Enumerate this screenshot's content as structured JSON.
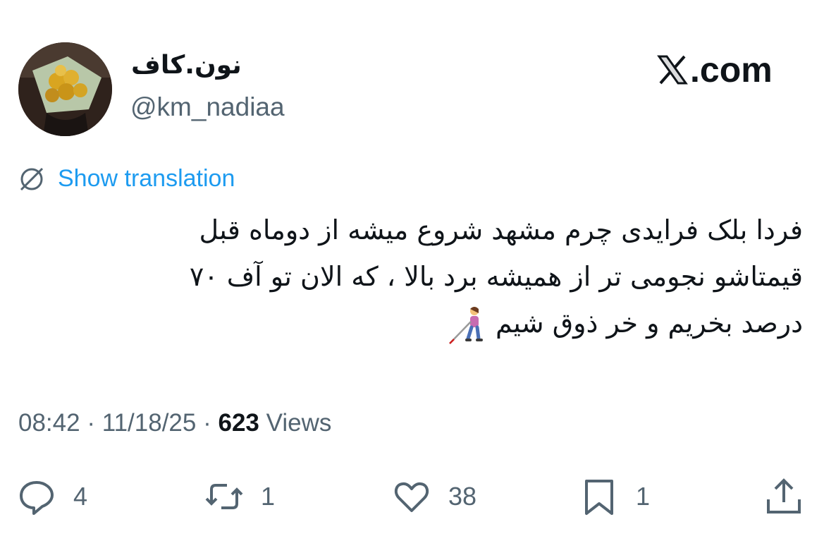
{
  "author": {
    "display_name": "نون.کاف",
    "handle": "@km_nadiaa"
  },
  "brand": {
    "label": ".com",
    "logo_icon": "x-logo-icon"
  },
  "translation": {
    "link_label": "Show translation",
    "icon": "globe-slash-icon"
  },
  "tweet": {
    "lines": [
      "فردا بلک فرایدی چرم مشهد شروع میشه از دوماه قبل",
      "قیمتاشو نجومی تر از همیشه برد بالا ، که الان تو آف ۷۰",
      "درصد بخریم و خر ذوق شیم"
    ],
    "emoji": "person-with-white-cane-emoji"
  },
  "meta": {
    "time": "08:42",
    "date": "11/18/25",
    "views_count": "623",
    "views_label": "Views",
    "separator": "·"
  },
  "actions": {
    "replies": "4",
    "reposts": "1",
    "likes": "38",
    "bookmarks": "1"
  },
  "colors": {
    "link": "#1d9bf0",
    "secondary_text": "#536471",
    "primary_text": "#0f1419"
  }
}
